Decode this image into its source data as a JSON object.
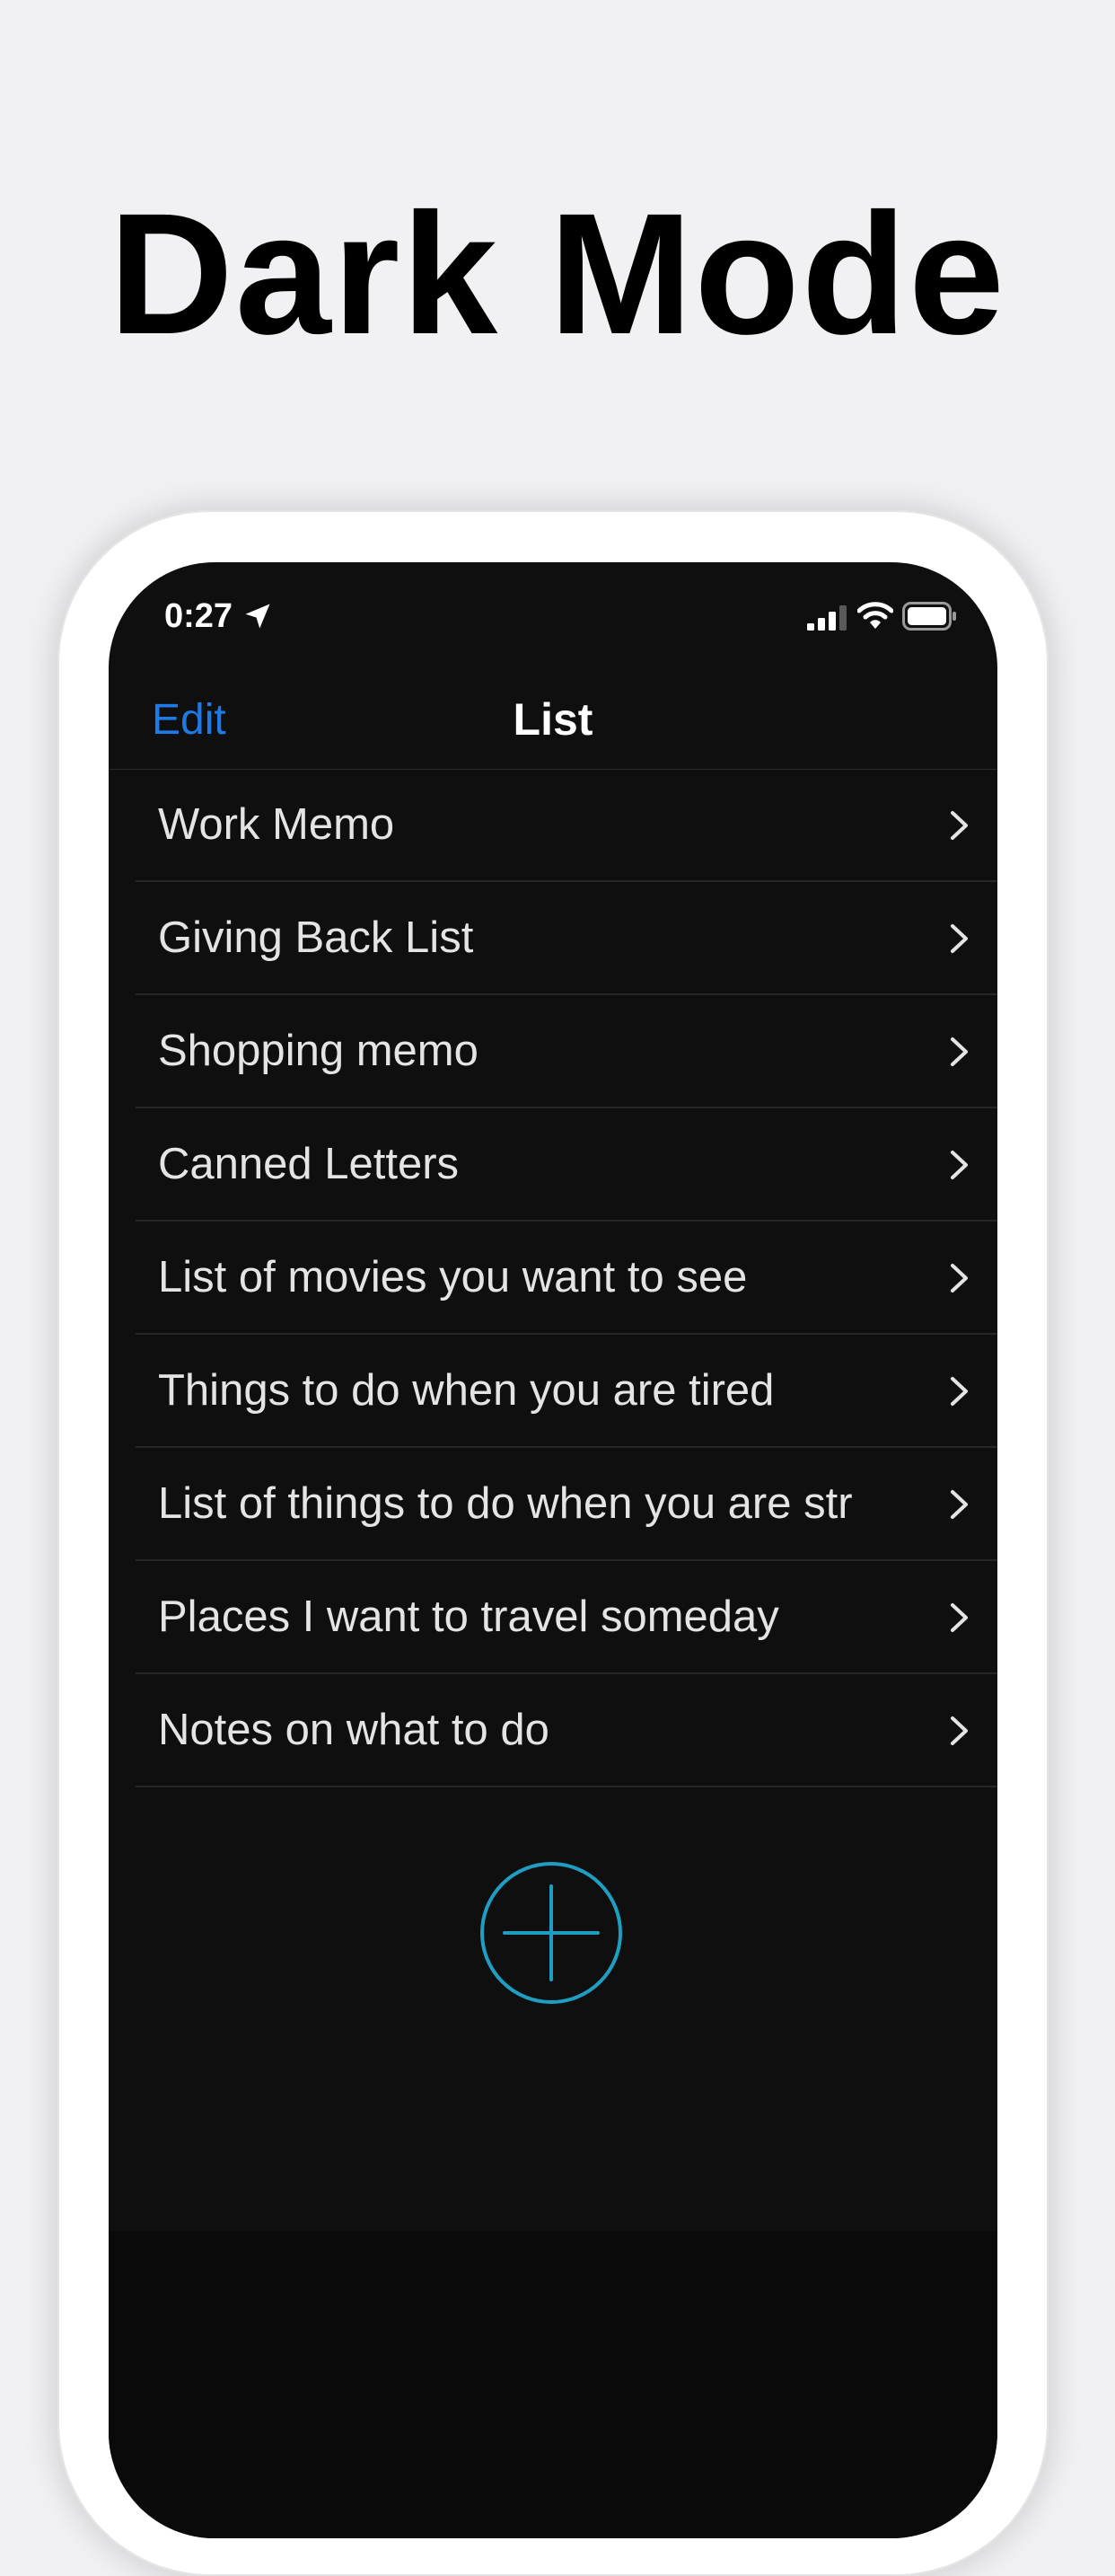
{
  "headline": "Dark Mode",
  "status_bar": {
    "time": "0:27"
  },
  "nav": {
    "edit_label": "Edit",
    "title": "List"
  },
  "list": {
    "items": [
      {
        "label": "Work Memo"
      },
      {
        "label": "Giving Back List"
      },
      {
        "label": "Shopping memo"
      },
      {
        "label": "Canned Letters"
      },
      {
        "label": "List of movies you want to see"
      },
      {
        "label": "Things to do when you are tired"
      },
      {
        "label": "List of things to do when you are str"
      },
      {
        "label": "Places I want to travel someday"
      },
      {
        "label": "Notes on what to do"
      }
    ]
  },
  "icons": {
    "location": "location-arrow-icon",
    "signal": "cellular-signal-icon",
    "wifi": "wifi-icon",
    "battery": "battery-icon",
    "chevron": "chevron-right-icon",
    "add": "plus-circle-icon"
  },
  "colors": {
    "accent_blue": "#1d7ae6",
    "add_button_teal": "#1f9ec4",
    "screen_background": "#0f0f0f",
    "page_background": "#f1f1f3"
  }
}
